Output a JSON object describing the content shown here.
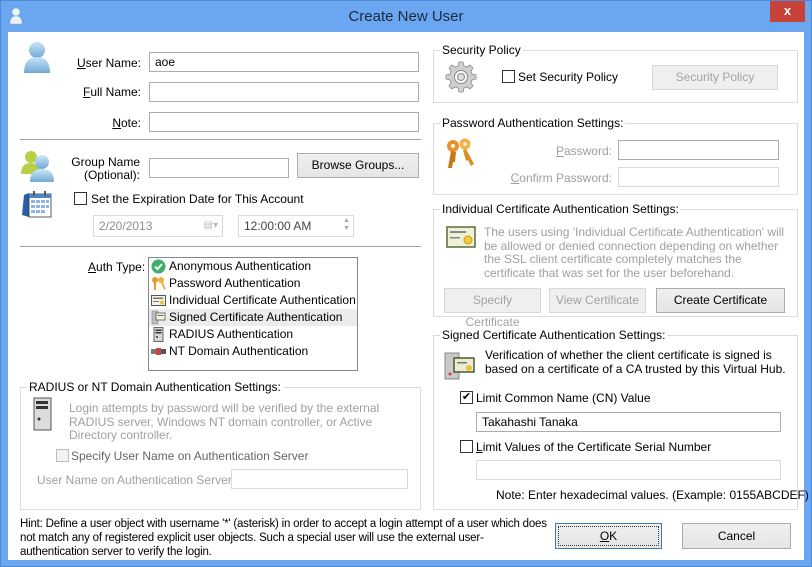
{
  "window": {
    "title": "Create New User",
    "close_label": "x",
    "title_icon": "user-icon"
  },
  "user": {
    "username_label": "User Name:",
    "username_value": "aoe",
    "fullname_label": "Full Name:",
    "fullname_value": "",
    "note_label": "Note:",
    "note_value": ""
  },
  "group": {
    "label_line1": "Group Name",
    "label_line2": "(Optional):",
    "value": "",
    "browse_label": "Browse Groups..."
  },
  "expiration": {
    "checkbox_label": "Set the Expiration Date for This Account",
    "checked": false,
    "date_value": "2/20/2013",
    "time_value": "12:00:00 AM"
  },
  "auth": {
    "label": "Auth Type:",
    "selected_index": 3,
    "items": [
      {
        "label": "Anonymous Authentication",
        "icon": "check-circle-icon"
      },
      {
        "label": "Password Authentication",
        "icon": "keys-icon"
      },
      {
        "label": "Individual Certificate Authentication",
        "icon": "certificate-icon"
      },
      {
        "label": "Signed Certificate Authentication",
        "icon": "signed-certificate-icon"
      },
      {
        "label": "RADIUS Authentication",
        "icon": "server-icon"
      },
      {
        "label": "NT Domain Authentication",
        "icon": "domain-icon"
      }
    ]
  },
  "radius": {
    "title": "RADIUS or NT Domain Authentication Settings:",
    "description": "Login attempts by password will be verified by the external RADIUS server, Windows NT domain controller, or Active Directory controller.",
    "specify_label": "Specify User Name on Authentication Server",
    "specify_checked": false,
    "server_user_label": "User Name on Authentication Server:",
    "server_user_value": ""
  },
  "security_policy": {
    "title": "Security Policy",
    "checkbox_label": "Set Security Policy",
    "checked": false,
    "button_label": "Security Policy"
  },
  "password": {
    "title": "Password Authentication Settings:",
    "password_label": "Password:",
    "password_value": "",
    "confirm_label": "Confirm Password:",
    "confirm_value": ""
  },
  "individual_cert": {
    "title": "Individual Certificate Authentication Settings:",
    "description": "The users using 'Individual Certificate Authentication' will be allowed or denied connection depending on whether the SSL client certificate completely matches the certificate that was set for the user beforehand.",
    "specify_label": "Specify Certificate",
    "view_label": "View Certificate",
    "create_label": "Create Certificate"
  },
  "signed_cert": {
    "title": "Signed Certificate Authentication Settings:",
    "description": "Verification of whether the client certificate is signed is based on a certificate of a CA trusted by this Virtual Hub.",
    "cn_label": "Limit Common Name (CN) Value",
    "cn_checked": true,
    "cn_value": "Takahashi Tanaka",
    "serial_label": "Limit Values of the Certificate Serial Number",
    "serial_checked": false,
    "serial_value": "",
    "note": "Note: Enter hexadecimal values. (Example: 0155ABCDEF)"
  },
  "footer": {
    "hint": "Hint: Define a user object with username '*' (asterisk) in order to accept a login attempt of a user which does not match any of registered explicit user objects. Such a special user will use the external user-authentication server to verify the login.",
    "ok_label": "OK",
    "cancel_label": "Cancel"
  },
  "colors": {
    "titlebar": "#6ba7f1",
    "close": "#c7433a"
  }
}
